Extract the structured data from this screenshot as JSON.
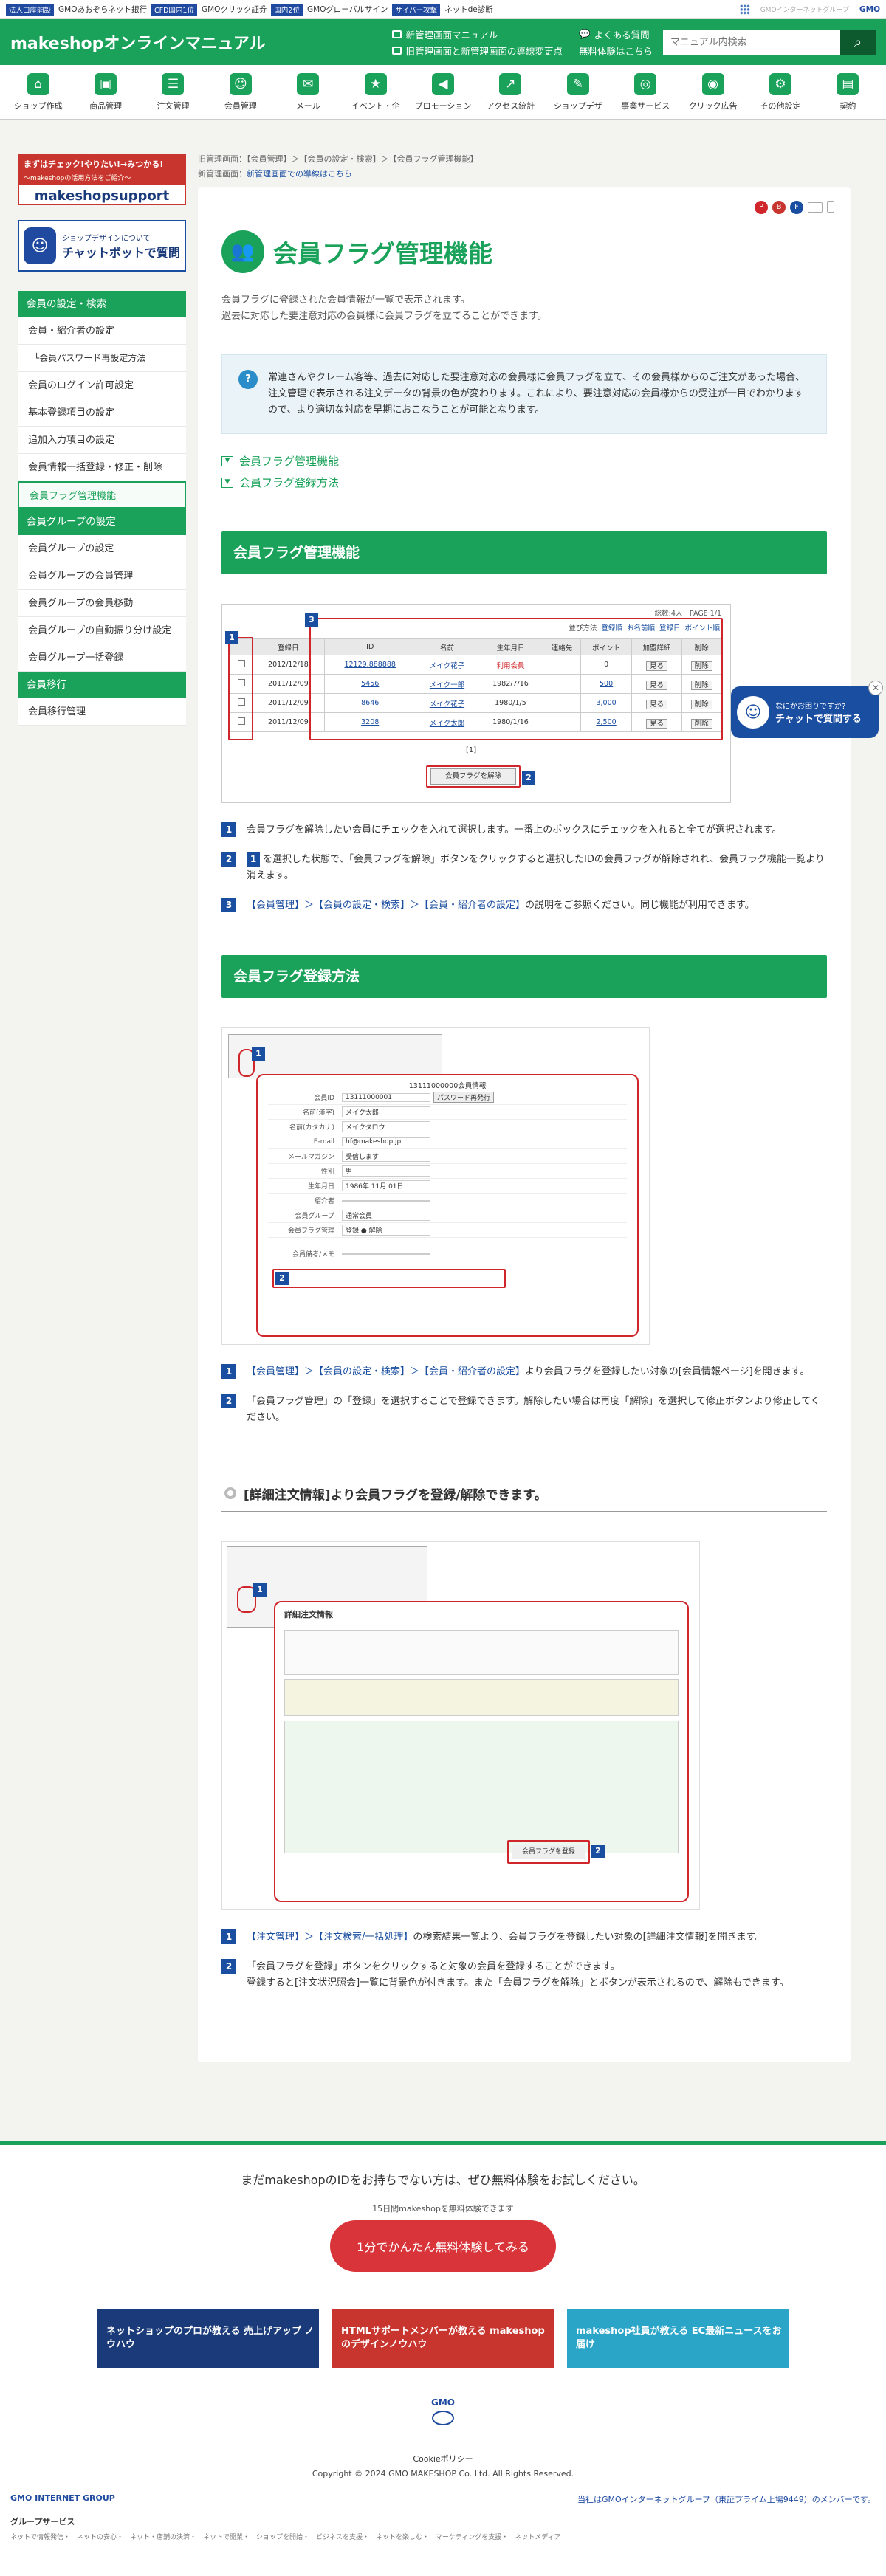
{
  "gmobar": {
    "items": [
      "法人口座開設",
      "GMOあおぞらネット銀行",
      "CFD国内1位",
      "GMOクリック証券",
      "国内2位",
      "GMOグローバルサイン",
      "サイバー攻撃",
      "ネットde診断"
    ],
    "tags": [
      "法人口座開設",
      "CFD国内1位",
      "国内2位",
      "サイバー攻撃"
    ],
    "brand": "GMO",
    "right_text": "GMOインターネットグループ"
  },
  "header": {
    "logo": "makeshopオンラインマニュアル",
    "links": [
      "新管理画面マニュアル",
      "旧管理画面と新管理画面の導線変更点",
      "よくある質問",
      "無料体験はこちら"
    ],
    "search_placeholder": "マニュアル内検索"
  },
  "catnav": {
    "items": [
      {
        "label": "ショップ作成",
        "icon": "⌂"
      },
      {
        "label": "商品管理",
        "icon": "▣"
      },
      {
        "label": "注文管理",
        "icon": "☰"
      },
      {
        "label": "会員管理",
        "icon": "☺"
      },
      {
        "label": "メール",
        "icon": "✉"
      },
      {
        "label": "イベント・企",
        "icon": "★"
      },
      {
        "label": "プロモーション",
        "icon": "◀"
      },
      {
        "label": "アクセス統計",
        "icon": "↗"
      },
      {
        "label": "ショップデザ",
        "icon": "✎"
      },
      {
        "label": "事業サービス",
        "icon": "◎"
      },
      {
        "label": "クリック広告",
        "icon": "◉"
      },
      {
        "label": "その他設定",
        "icon": "⚙"
      },
      {
        "label": "契約",
        "icon": "▤"
      }
    ]
  },
  "sidebar": {
    "banner1_top": "まずはチェック!やりたい!→みつかる!",
    "banner1_sub": "～makeshopの活用方法をご紹介～",
    "banner1_brand": "makeshopsupport",
    "banner2_t1": "ショップデザインについて",
    "banner2_t2": "チャットボットで質問",
    "menu": [
      {
        "label": "会員の設定・検索",
        "type": "hdr"
      },
      {
        "label": "会員・紹介者の設定",
        "type": "it"
      },
      {
        "label": "└会員パスワード再設定方法",
        "type": "sub"
      },
      {
        "label": "会員のログイン許可設定",
        "type": "it"
      },
      {
        "label": "基本登録項目の設定",
        "type": "it"
      },
      {
        "label": "追加入力項目の設定",
        "type": "it"
      },
      {
        "label": "会員情報一括登録・修正・削除",
        "type": "it"
      },
      {
        "label": "会員フラグ管理機能",
        "type": "active"
      },
      {
        "label": "会員グループの設定",
        "type": "hdr"
      },
      {
        "label": "会員グループの設定",
        "type": "it"
      },
      {
        "label": "会員グループの会員管理",
        "type": "it"
      },
      {
        "label": "会員グループの会員移動",
        "type": "it"
      },
      {
        "label": "会員グループの自動振り分け設定",
        "type": "it"
      },
      {
        "label": "会員グループ一括登録",
        "type": "it"
      },
      {
        "label": "会員移行",
        "type": "hdr"
      },
      {
        "label": "会員移行管理",
        "type": "it"
      }
    ]
  },
  "breadcrumb": {
    "line1": "旧管理画面：【会員管理】＞【会員の設定・検索】＞【会員フラグ管理機能】",
    "line2_prefix": "新管理画面：",
    "line2_link": "新管理画面での導線はこちら"
  },
  "badges": [
    "P",
    "B",
    "F"
  ],
  "page": {
    "title": "会員フラグ管理機能",
    "lead1": "会員フラグに登録された会員情報が一覧で表示されます。",
    "lead2": "過去に対応した要注意対応の会員様に会員フラグを立てることができます。",
    "note": "常連さんやクレーム客等、過去に対応した要注意対応の会員様に会員フラグを立て、その会員様からのご注文があった場合、注文管理で表示される注文データの背景の色が変わります。これにより、要注意対応の会員様からの受注が一目でわかりますので、より適切な対応を早期におこなうことが可能となります。",
    "anchors": [
      "会員フラグ管理機能",
      "会員フラグ登録方法"
    ]
  },
  "sec1": {
    "title": "会員フラグ管理機能",
    "table": {
      "total": "総数:4人　PAGE 1/1",
      "sort_label": "並び方法",
      "sort_links": [
        "登録順",
        "お名前順",
        "登録日",
        "ポイント順"
      ],
      "headers": [
        "登録日",
        "ID",
        "名前",
        "生年月日",
        "連絡先",
        "ポイント",
        "加盟詳細",
        "削除"
      ],
      "rows": [
        [
          "2012/12/18",
          "12129.888888",
          "メイク花子",
          "利用会員",
          "",
          "0",
          "見る",
          "削除"
        ],
        [
          "2011/12/09",
          "5456",
          "メイク一郎",
          "1982/7/16",
          "",
          "500",
          "見る",
          "削除"
        ],
        [
          "2011/12/09",
          "8646",
          "メイク花子",
          "1980/1/5",
          "",
          "3,000",
          "見る",
          "削除"
        ],
        [
          "2011/12/09",
          "3208",
          "メイク太郎",
          "1980/1/16",
          "",
          "2,500",
          "見る",
          "削除"
        ]
      ],
      "page": "[1]",
      "release_btn": "会員フラグを解除"
    },
    "steps": [
      "会員フラグを解除したい会員にチェックを入れて選択します。一番上のボックスにチェックを入れると全てが選択されます。",
      "を選択した状態で、「会員フラグを解除」ボタンをクリックすると選択したIDの会員フラグが解除されれ、会員フラグ機能一覧より消えます。",
      "【会員管理】＞【会員の設定・検索】＞【会員・紹介者の設定】の説明をご参照ください。同じ機能が利用できます。"
    ],
    "step3_link": "【会員管理】＞【会員の設定・検索】＞【会員・紹介者の設定】",
    "step3_rest": "の説明をご参照ください。同じ機能が利用できます。"
  },
  "sec2": {
    "title": "会員フラグ登録方法",
    "popup": {
      "title": "13111000000会員情報",
      "rows": [
        "会員ID",
        "名前(漢字)",
        "名前(カタカナ)",
        "E-mail",
        "メールマガジン",
        "性別",
        "生年月日",
        "紹介者",
        "会員グループ",
        "会員フラグ管理",
        "会員備考/メモ"
      ],
      "vals": [
        "13111000001",
        "メイク太郎",
        "メイクタロウ",
        "hf@makeshop.jp",
        "受信します",
        "男",
        "1986年 11月 01日",
        "",
        "通常会員",
        "登録 ● 解除",
        ""
      ],
      "pwd_btn": "パスワード再発行"
    },
    "step1_link": "【会員管理】＞【会員の設定・検索】＞【会員・紹介者の設定】",
    "step1_rest": "より会員フラグを登録したい対象の[会員情報ページ]を開きます。",
    "step2": "「会員フラグ管理」の「登録」を選択することで登録できます。解除したい場合は再度「解除」を選択して修正ボタンより修正してください。"
  },
  "sec3": {
    "title": "[詳細注文情報]より会員フラグを登録/解除できます。",
    "popup_title": "詳細注文情報",
    "reg_btn": "会員フラグを登録",
    "step1_link": "【注文管理】＞【注文検索/一括処理】",
    "step1_rest": "の検索結果一覧より、会員フラグを登録したい対象の[詳細注文情報]を開きます。",
    "step2a": "「会員フラグを登録」ボタンをクリックすると対象の会員を登録することができます。",
    "step2b": "登録すると[注文状況照会]一覧に背景色が付きます。また「会員フラグを解除」とボタンが表示されるので、解除もできます。"
  },
  "chat_float": {
    "t1": "なにかお困りですか?",
    "t2": "チャットで質問する"
  },
  "footer": {
    "cta": "まだmakeshopのIDをお持ちでない方は、ぜひ無料体験をお試しください。",
    "small": "15日間makeshopを無料体験できます",
    "btn": "1分でかんたん無料体験してみる",
    "banners": [
      {
        "label": "ネットショップのプロが教える 売上げアップ ノウハウ",
        "color": "#1a3a7a"
      },
      {
        "label": "HTMLサポートメンバーが教える makeshopのデザインノウハウ",
        "color": "#c8352f"
      },
      {
        "label": "makeshop社員が教える EC最新ニュースをお届け",
        "color": "#2aa5c8"
      }
    ],
    "gmo_badge": "GMO",
    "cookie": "Cookieポリシー",
    "copyright": "Copyright © 2024 GMO MAKESHOP Co. Ltd. All Rights Reserved.",
    "gmo_logo": "GMO INTERNET GROUP",
    "gmo_member": "当社はGMOインターネットグループ（東証プライム上場9449）のメンバーです。",
    "group_services": "グループサービス",
    "links": "ネットで情報発信・　ネットの安心・　ネット・店舗の決済・　ネットで開業・　ショップを開始・　ビジネスを支援・　ネットを楽しむ・　マーケティングを支援・　ネットメディア"
  }
}
